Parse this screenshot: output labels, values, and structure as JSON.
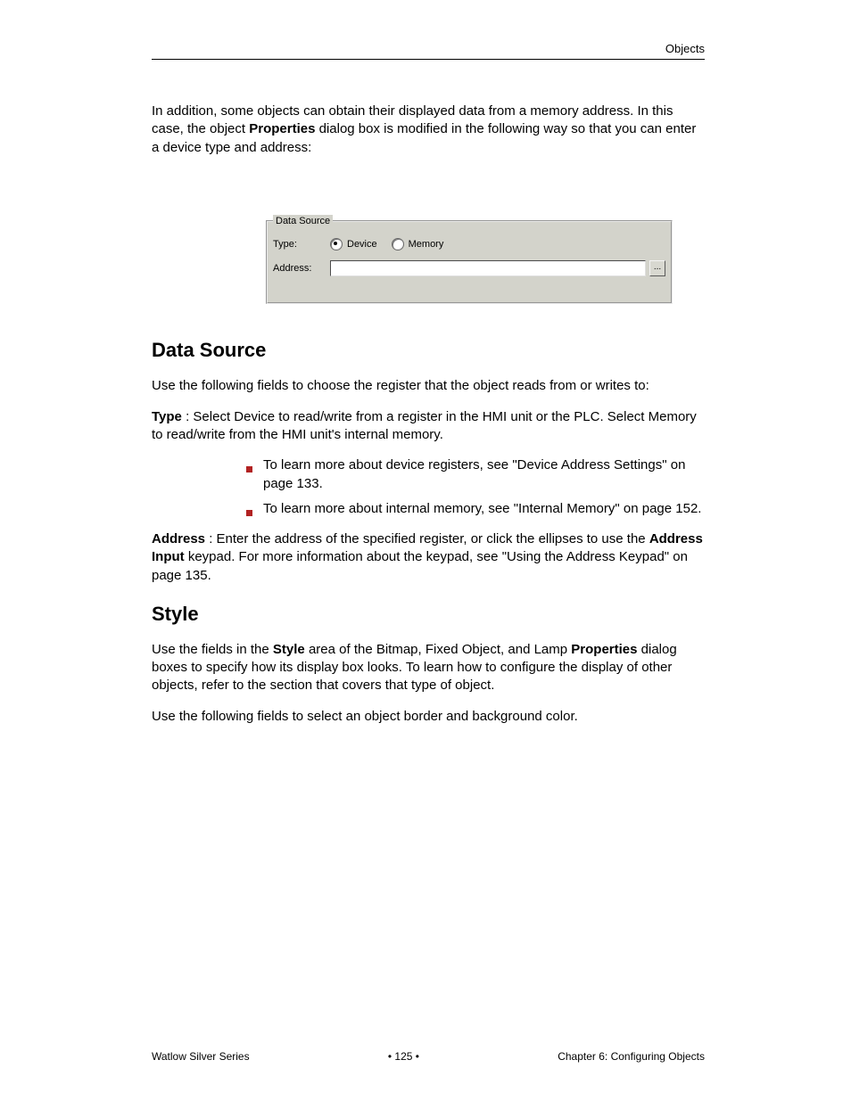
{
  "header": {
    "right": "Objects"
  },
  "intro": {
    "para1_before_bold": "In addition, some objects can obtain their displayed data from a memory address. In this case, the object ",
    "para1_bold": "Properties",
    "para1_after_bold": " dialog box is modified in the following way so that you can enter a device type and address:",
    "para2": "Use the following fields to choose the register that the object reads from or writes to:"
  },
  "groupbox": {
    "legend": "Data Source",
    "type_label": "Type:",
    "radio_device": "Device",
    "radio_memory": "Memory",
    "radio_selected": "device",
    "address_label": "Address:",
    "address_value": "",
    "browse_label": "..."
  },
  "section": {
    "title": "Data Source"
  },
  "fields": {
    "type": {
      "label_bold": "Type",
      "desc1": "Select Device to read/write from a register in the HMI unit or the PLC. Select Memory to read/write from the HMI unit's internal memory.",
      "bullet1_prefix": "To learn more about device registers, ",
      "bullet1_link": "see \"Device Address Settings\" on page 133.",
      "bullet2_prefix": "To learn more about internal memory, ",
      "bullet2_link": "see \"Internal Memory\" on page 152."
    },
    "address": {
      "label_bold": "Address",
      "desc_part1": "Enter the address of the specified register, or click the ellipses to use the ",
      "desc_bold": "Address Input",
      "desc_part2_before_link": " keypad. For more information about the keypad, ",
      "desc_link": "see \"Using the Address Keypad\" on page 135."
    }
  },
  "section2": {
    "title": "Style",
    "para_before_bold": "Use the fields in the ",
    "para_bold": "Style",
    "para_mid": " area of the Bitmap, Fixed Object, and Lamp ",
    "para_bold2": "Properties",
    "para_after": " dialog boxes to specify how its display box looks. To learn how to configure the display of other objects, refer to the section that covers that type of object.",
    "trailing": "Use the following fields to select an object border and background color."
  },
  "footer": {
    "left": "Watlow Silver Series",
    "right": "•   125   •",
    "right2": "Chapter 6: Configuring Objects"
  }
}
